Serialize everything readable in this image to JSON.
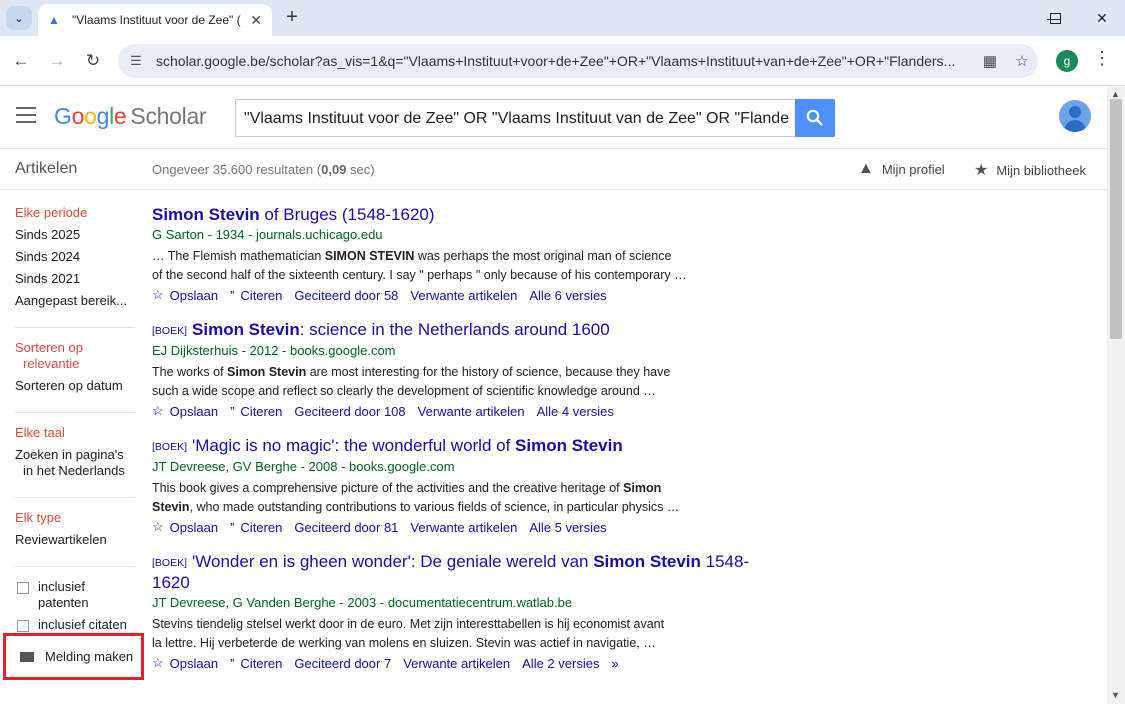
{
  "browser": {
    "tab_title": "\"Vlaams Instituut voor de Zee\" (",
    "url": "scholar.google.be/scholar?as_vis=1&q=\"Vlaams+Instituut+voor+de+Zee\"+OR+\"Vlaams+Instituut+van+de+Zee\"+OR+\"Flanders...",
    "profile_initial": "g"
  },
  "header": {
    "logo_google": [
      "G",
      "o",
      "o",
      "g",
      "l",
      "e"
    ],
    "logo_scholar": "Scholar",
    "search_value": "\"Vlaams Instituut voor de Zee\" OR \"Vlaams Instituut van de Zee\" OR \"Flande"
  },
  "subbar": {
    "section": "Artikelen",
    "results_prefix": "Ongeveer 35.600 resultaten (",
    "results_time": "0,09",
    "results_suffix": " sec)",
    "profile_link": "Mijn profiel",
    "library_link": "Mijn bibliotheek"
  },
  "sidebar": {
    "period": [
      "Elke periode",
      "Sinds 2025",
      "Sinds 2024",
      "Sinds 2021",
      "Aangepast bereik..."
    ],
    "sort_active_1": "Sorteren op",
    "sort_active_2": "relevantie",
    "sort_date": "Sorteren op datum",
    "lang_any": "Elke taal",
    "lang_nl_1": "Zoeken in pagina's",
    "lang_nl_2": "in het Nederlands",
    "type_any": "Elk type",
    "type_review": "Reviewartikelen",
    "incl_patents_1": "inclusief",
    "incl_patents_2": "patenten",
    "incl_citations": "inclusief citaten",
    "alert": "Melding maken"
  },
  "results": [
    {
      "tag": "",
      "title_bold": "Simon Stevin",
      "title_rest": " of Bruges (1548-1620)",
      "meta": "G Sarton - 1934 - journals.uchicago.edu",
      "snip1_a": "… The Flemish mathematician ",
      "snip1_b": "SIMON STEVIN",
      "snip1_c": " was perhaps the most original man of science",
      "snip2": "of the second half of the sixteenth century. I say \" perhaps \" only because of his contemporary …",
      "save": "Opslaan",
      "cite": "Citeren",
      "cited": "Geciteerd door 58",
      "related": "Verwante artikelen",
      "versions": "Alle 6 versies"
    },
    {
      "tag": "[BOEK]",
      "title_bold": "Simon Stevin",
      "title_rest": ": science in the Netherlands around 1600",
      "meta": "EJ Dijksterhuis - 2012 - books.google.com",
      "snip1_a": "The works of ",
      "snip1_b": "Simon Stevin",
      "snip1_c": " are most interesting for the history of science, because they have",
      "snip2": "such a wide scope and reflect so clearly the development of scientific knowledge around …",
      "save": "Opslaan",
      "cite": "Citeren",
      "cited": "Geciteerd door 108",
      "related": "Verwante artikelen",
      "versions": "Alle 4 versies"
    },
    {
      "tag": "[BOEK]",
      "title_pre": "'Magic is no magic': the wonderful world of ",
      "title_bold": "Simon Stevin",
      "meta": "JT Devreese, GV Berghe - 2008 - books.google.com",
      "snip1_a": "This book gives a comprehensive picture of the activities and the creative heritage of ",
      "snip1_b": "Simon",
      "snip2_b": "Stevin",
      "snip2": ", who made outstanding contributions to various fields of science, in particular physics …",
      "save": "Opslaan",
      "cite": "Citeren",
      "cited": "Geciteerd door 81",
      "related": "Verwante artikelen",
      "versions": "Alle 5 versies"
    },
    {
      "tag": "[BOEK]",
      "title_pre": "'Wonder en is gheen wonder': De geniale wereld van ",
      "title_bold": "Simon Stevin",
      "title_rest": " 1548-",
      "title_line2": "1620",
      "meta": "JT Devreese, G Vanden Berghe - 2003 - documentatiecentrum.watlab.be",
      "snip1": "Stevins tiendelig stelsel werkt door in de euro. Met zijn interesttabellen is hij economist avant",
      "snip2": "la lettre. Hij verbeterde de werking van molens en sluizen. Stevin was actief in navigatie, …",
      "save": "Opslaan",
      "cite": "Citeren",
      "cited": "Geciteerd door 7",
      "related": "Verwante artikelen",
      "versions": "Alle 2 versies"
    }
  ],
  "colors": {
    "link": "#1a0dab",
    "source": "#006621",
    "filter_active": "#dd4b39",
    "search_button": "#4d90fe",
    "highlight_box": "#e2212c"
  }
}
